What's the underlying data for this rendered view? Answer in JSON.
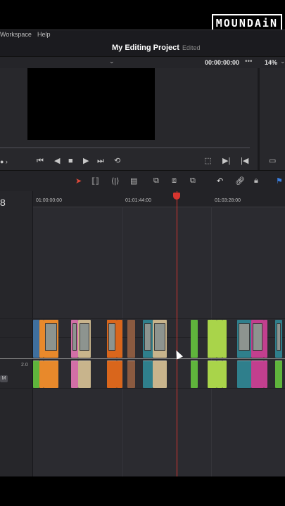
{
  "logo": {
    "text": "MOUNDAiN"
  },
  "menu": {
    "workspace": "Workspace",
    "help": "Help"
  },
  "title": {
    "project": "My Editing Project",
    "status": "Edited"
  },
  "viewer": {
    "timecode": "00:00:00:00",
    "zoom": "14%",
    "more": "•••",
    "chevron": "⌄"
  },
  "transport": {
    "first": "⏮",
    "prev": "◀",
    "stop": "■",
    "play": "▶",
    "last": "⏭",
    "loop": "⟲",
    "left_dot": "● ›"
  },
  "timeline": {
    "code_partial": "8",
    "ruler_labels": [
      "01:00:00:00",
      "01:01:44:00",
      "01:03:28:00"
    ],
    "audio_level": "2.0",
    "mute": "M"
  },
  "colors": {
    "playhead": "#d8352f",
    "blue": "#3f6f9e",
    "orange": "#e8892b",
    "pink": "#d26fa6",
    "tan": "#c8b48c",
    "brown": "#8a5a40",
    "teal": "#2f7f8c",
    "green": "#5fb43c",
    "lime": "#a9d44a",
    "magenta": "#c23f8e",
    "darkorange": "#d9661c"
  }
}
